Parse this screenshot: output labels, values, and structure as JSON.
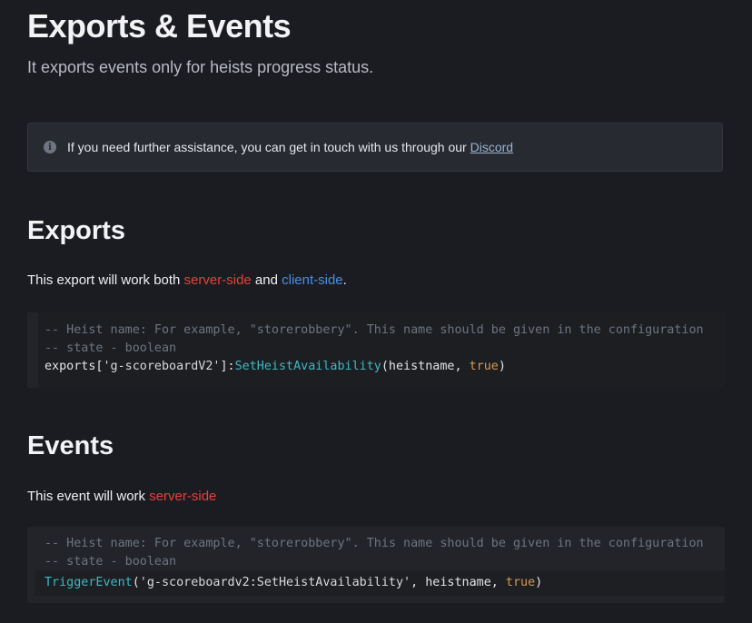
{
  "header": {
    "title": "Exports & Events",
    "subtitle": "It exports events only for heists progress status."
  },
  "hint": {
    "icon": "info-icon",
    "text": "If you need further assistance, you can get in touch with us through our ",
    "link": "Discord"
  },
  "exports": {
    "heading": "Exports",
    "intro_prefix": "This export will work both ",
    "intro_server": "server-side",
    "intro_and": " and ",
    "intro_client": "client-side",
    "intro_suffix": ".",
    "code": {
      "comment1": "-- Heist name: For example, \"storerobbery\". This name should be given in the configuration",
      "comment2": "-- state - boolean",
      "call_prefix": "exports[",
      "call_string": "'g-scoreboardV2'",
      "call_mid": "]:",
      "call_fn": "SetHeistAvailability",
      "call_open": "(heistname, ",
      "call_bool": "true",
      "call_close": ")"
    }
  },
  "events": {
    "heading": "Events",
    "intro_prefix": "This event will work ",
    "intro_server": "server-side",
    "code": {
      "comment1": "-- Heist name: For example, \"storerobbery\". This name should be given in the configuration",
      "comment2": "-- state - boolean",
      "call_fn": "TriggerEvent",
      "call_open": "(",
      "call_string": "'g-scoreboardv2:SetHeistAvailability'",
      "call_args": ", heistname, ",
      "call_bool": "true",
      "call_close": ")"
    }
  },
  "colors": {
    "background": "#1b1c21",
    "server_side": "#e0443a",
    "client_side": "#4a8fe6",
    "function": "#3fb8c2",
    "boolean": "#d69a52",
    "link": "#9cb3cf"
  }
}
